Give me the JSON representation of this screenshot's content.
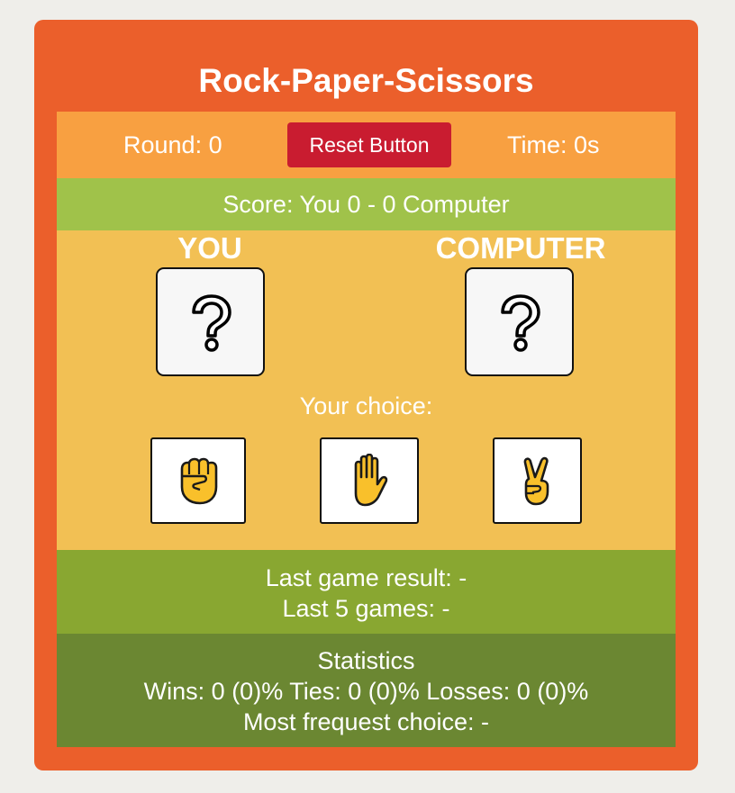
{
  "title": "Rock-Paper-Scissors",
  "topbar": {
    "round": "Round: 0",
    "reset_label": "Reset Button",
    "time": "Time: 0s"
  },
  "score": "Score: You 0 - 0 Computer",
  "players": {
    "you_label": "YOU",
    "computer_label": "COMPUTER",
    "you_hand_icon": "question-mark-icon",
    "computer_hand_icon": "question-mark-icon"
  },
  "choice": {
    "label": "Your choice:",
    "options": [
      {
        "id": "rock",
        "icon": "raised-fist-icon"
      },
      {
        "id": "paper",
        "icon": "raised-hand-icon"
      },
      {
        "id": "scissors",
        "icon": "victory-hand-icon"
      }
    ]
  },
  "result": {
    "last_game": "Last game result: -",
    "last_five": "Last 5 games: -"
  },
  "stats": {
    "heading": "Statistics",
    "summary": "Wins: 0 (0)% Ties: 0 (0)% Losses: 0 (0)%",
    "most_frequent": "Most frequest choice: -"
  },
  "colors": {
    "card": "#eb5f2b",
    "topbar": "#f8a041",
    "reset_button": "#c91c30",
    "scorebar": "#a0c24a",
    "playarea": "#f2c054",
    "resultbar": "#89a731",
    "statsbar": "#6b8732"
  }
}
